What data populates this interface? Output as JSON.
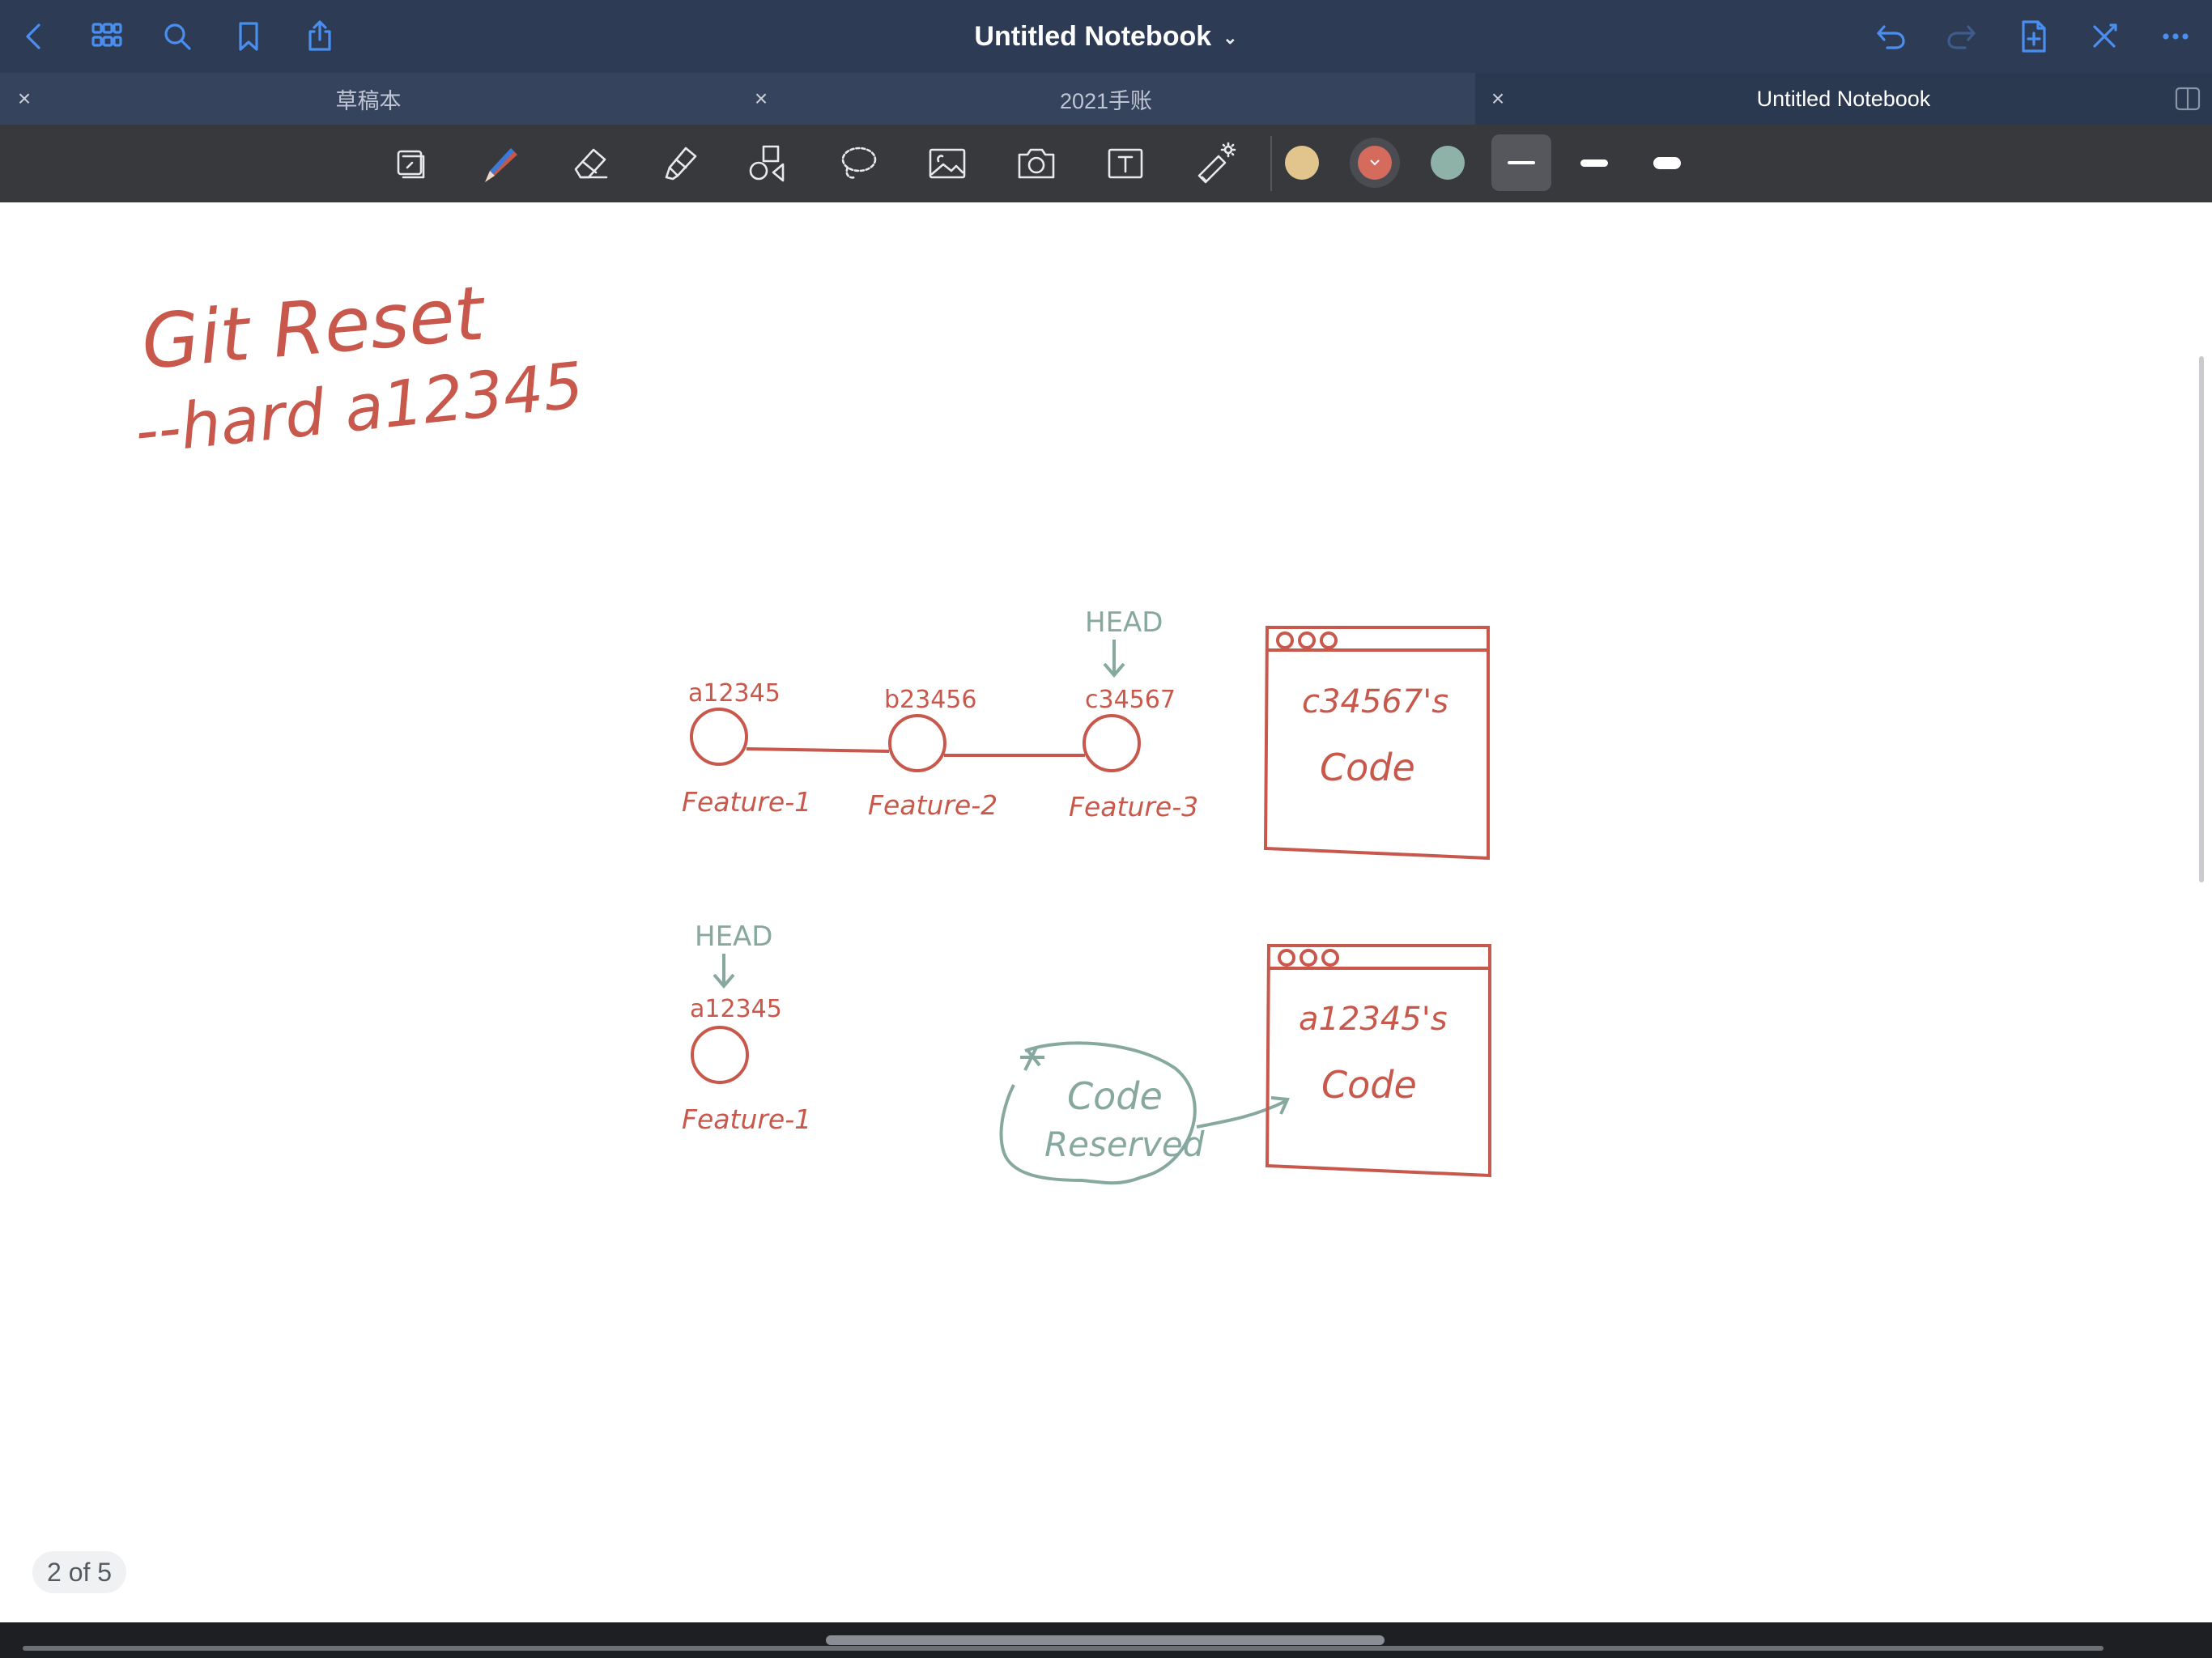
{
  "app": {
    "title": "Untitled Notebook",
    "title_chevron": "⌄"
  },
  "header_icons": {
    "left": [
      "back-icon",
      "grid-icon",
      "search-icon",
      "bookmark-icon",
      "share-icon"
    ],
    "right": [
      "undo-icon",
      "redo-icon",
      "add-page-icon",
      "close-pen-icon",
      "more-icon"
    ]
  },
  "tabs": [
    {
      "label": "草稿本",
      "active": false,
      "close": "×"
    },
    {
      "label": "2021手账",
      "active": false,
      "close": "×"
    },
    {
      "label": "Untitled Notebook",
      "active": true,
      "close": "×"
    }
  ],
  "toolbar": {
    "tools": [
      "page-layout-icon",
      "pen-icon",
      "eraser-icon",
      "highlighter-icon",
      "shapes-icon",
      "lasso-icon",
      "image-icon",
      "camera-icon",
      "text-icon",
      "laser-pointer-icon"
    ],
    "active_tool": "pen-icon",
    "colors": [
      "#e2c58c",
      "#d46b5c",
      "#8fb2a8"
    ],
    "active_color": "#d46b5c",
    "thickness_options": [
      "thin",
      "medium",
      "thick"
    ],
    "active_thickness": "thin",
    "bluetooth_indicator": "bluetooth-icon"
  },
  "notes": {
    "title_line1": "Git Reset",
    "title_line2": "--hard  a12345",
    "commits_top": [
      {
        "id": "a12345",
        "label": "Feature-1"
      },
      {
        "id": "b23456",
        "label": "Feature-2"
      },
      {
        "id": "c34567",
        "label": "Feature-3"
      }
    ],
    "head_top": "HEAD",
    "window_top_line1": "c34567's",
    "window_top_line2": "Code",
    "head_bottom": "HEAD",
    "commit_bottom": {
      "id": "a12345",
      "label": "Feature-1"
    },
    "cloud_line1": "Code",
    "cloud_line2": "Reserved",
    "window_bottom_line1": "a12345's",
    "window_bottom_line2": "Code",
    "ink_red": "#c8584b",
    "ink_teal": "#86a89e"
  },
  "page_indicator": "2 of 5"
}
